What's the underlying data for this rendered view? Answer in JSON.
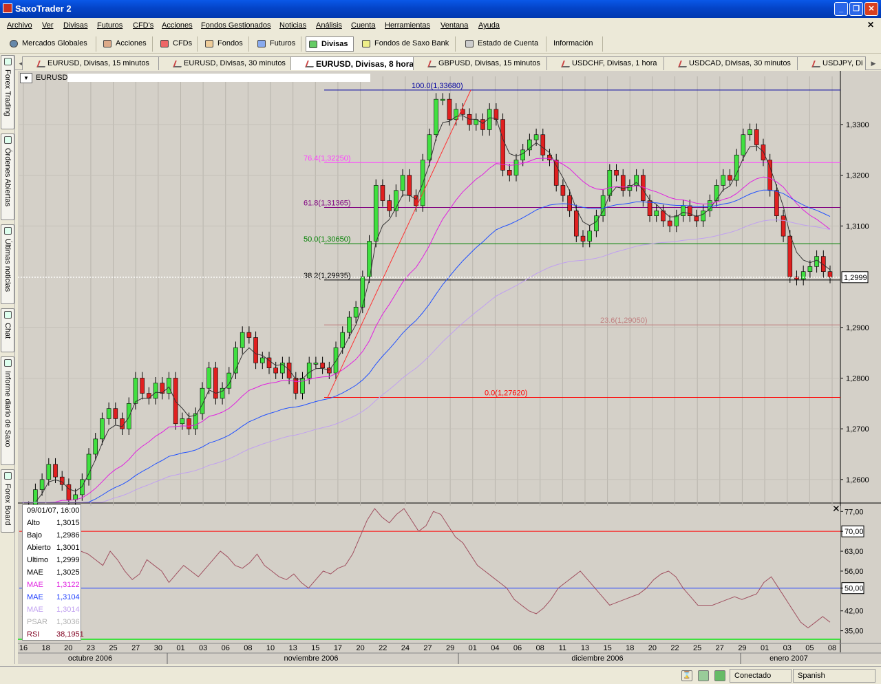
{
  "window": {
    "title": "SaxoTrader 2",
    "minimize_icon": "minimize-icon",
    "maximize_icon": "restore-icon",
    "close_icon": "close-icon"
  },
  "menu": {
    "items": [
      "Archivo",
      "Ver",
      "Divisas",
      "Futuros",
      "CFD's",
      "Acciones",
      "Fondos Gestionados",
      "Noticias",
      "Análisis",
      "Cuenta",
      "Herramientas",
      "Ventana",
      "Ayuda"
    ]
  },
  "toolbar": {
    "items": [
      {
        "label": "Mercados Globales",
        "icon": "globe-icon"
      },
      {
        "label": "Acciones",
        "icon": "stocks-icon"
      },
      {
        "label": "CFDs",
        "icon": "cfd-icon"
      },
      {
        "label": "Fondos",
        "icon": "funds-icon"
      },
      {
        "label": "Futuros",
        "icon": "futures-icon"
      },
      {
        "label": "Divisas",
        "icon": "forex-icon"
      },
      {
        "label": "Fondos de Saxo Bank",
        "icon": "saxo-funds-icon"
      },
      {
        "label": "Estado de Cuenta",
        "icon": "account-icon"
      },
      {
        "label": "Información",
        "icon": ""
      }
    ]
  },
  "sidebar": {
    "tabs": [
      "Forex Trading",
      "Órdenes Abiertas",
      "Últimas noticias",
      "Chat",
      "Informe diario de Saxo",
      "Forex Board"
    ]
  },
  "chart_tabs": [
    "EURUSD, Divisas, 15 minutos",
    "EURUSD, Divisas, 30 minutos",
    "EURUSD, Divisas, 8 horas",
    "GBPUSD, Divisas, 15 minutos",
    "USDCHF, Divisas, 1 hora",
    "USDCAD, Divisas, 30 minutos",
    "USDJPY, Di"
  ],
  "active_tab": 2,
  "symbol": "EURUSD",
  "chart_data": {
    "type": "line",
    "title": "EURUSD",
    "x_dates": [
      "16",
      "18",
      "20",
      "23",
      "25",
      "27",
      "30",
      "01",
      "03",
      "06",
      "08",
      "10",
      "13",
      "15",
      "17",
      "20",
      "22",
      "24",
      "27",
      "29",
      "01",
      "04",
      "06",
      "08",
      "11",
      "13",
      "15",
      "18",
      "20",
      "22",
      "25",
      "27",
      "29",
      "01",
      "03",
      "05",
      "08"
    ],
    "months": [
      "octubre 2006",
      "noviembre 2006",
      "diciembre 2006",
      "enero 2007"
    ],
    "price_axis": {
      "ticks": [
        "1,3300",
        "1,3200",
        "1,3100",
        "1,2999",
        "1,2900",
        "1,2800",
        "1,2700",
        "1,2600"
      ],
      "values": [
        1.33,
        1.32,
        1.31,
        1.2999,
        1.29,
        1.28,
        1.27,
        1.26
      ],
      "range": [
        1.2555,
        1.3395
      ],
      "current": "1,2999"
    },
    "fibonacci": [
      {
        "label": "100.0(1,33680)",
        "value": 1.3368,
        "color": "#0000a0"
      },
      {
        "label": "76.4(1,32250)",
        "value": 1.3225,
        "color": "#ff40ff"
      },
      {
        "label": "61.8(1,31365)",
        "value": 1.31365,
        "color": "#800080"
      },
      {
        "label": "50.0(1,30650)",
        "value": 1.3065,
        "color": "#008000"
      },
      {
        "label": "38.2(1,29935)",
        "value": 1.29935,
        "color": "#000000"
      },
      {
        "label": "23.6(1,29050)",
        "value": 1.2905,
        "color": "#c08080"
      },
      {
        "label": "0.0(1,27620)",
        "value": 1.2762,
        "color": "#ff0000"
      }
    ],
    "close_series": [
      1.253,
      1.2545,
      1.258,
      1.26,
      1.263,
      1.2605,
      1.259,
      1.256,
      1.257,
      1.26,
      1.265,
      1.268,
      1.272,
      1.274,
      1.272,
      1.27,
      1.275,
      1.28,
      1.277,
      1.276,
      1.279,
      1.277,
      1.28,
      1.271,
      1.272,
      1.27,
      1.273,
      1.278,
      1.282,
      1.276,
      1.278,
      1.281,
      1.286,
      1.289,
      1.288,
      1.283,
      1.284,
      1.282,
      1.281,
      1.283,
      1.28,
      1.277,
      1.28,
      1.283,
      1.283,
      1.282,
      1.281,
      1.286,
      1.289,
      1.292,
      1.294,
      1.3,
      1.307,
      1.318,
      1.315,
      1.313,
      1.317,
      1.32,
      1.316,
      1.314,
      1.323,
      1.328,
      1.335,
      1.335,
      1.331,
      1.333,
      1.332,
      1.33,
      1.331,
      1.329,
      1.333,
      1.331,
      1.321,
      1.32,
      1.323,
      1.325,
      1.327,
      1.328,
      1.324,
      1.323,
      1.318,
      1.316,
      1.313,
      1.308,
      1.307,
      1.309,
      1.312,
      1.316,
      1.321,
      1.32,
      1.317,
      1.318,
      1.32,
      1.315,
      1.312,
      1.313,
      1.311,
      1.31,
      1.312,
      1.314,
      1.312,
      1.311,
      1.313,
      1.315,
      1.318,
      1.32,
      1.319,
      1.324,
      1.328,
      1.329,
      1.326,
      1.323,
      1.317,
      1.312,
      1.308,
      1.3,
      1.2995,
      1.301,
      1.302,
      1.304,
      1.301,
      1.2999
    ],
    "rsi": {
      "ticks": [
        "77,00",
        "70,00",
        "63,00",
        "56,00",
        "50,00",
        "42,00",
        "35,00"
      ],
      "values": [
        77,
        70,
        63,
        56,
        50,
        42,
        35
      ],
      "range": [
        32,
        79
      ],
      "levels": [
        70,
        50
      ],
      "series": [
        40,
        44,
        47,
        46,
        50,
        54,
        58,
        61,
        63,
        62,
        60,
        58,
        63,
        60,
        56,
        53,
        55,
        60,
        58,
        56,
        52,
        55,
        58,
        56,
        54,
        57,
        60,
        63,
        61,
        58,
        57,
        59,
        62,
        58,
        56,
        54,
        53,
        55,
        52,
        50,
        53,
        56,
        55,
        57,
        58,
        62,
        68,
        74,
        78,
        75,
        73,
        76,
        78,
        74,
        70,
        72,
        77,
        76,
        72,
        68,
        66,
        62,
        58,
        56,
        54,
        52,
        50,
        46,
        44,
        42,
        41,
        43,
        46,
        50,
        52,
        54,
        56,
        53,
        50,
        47,
        44,
        45,
        46,
        47,
        48,
        50,
        53,
        55,
        56,
        54,
        50,
        47,
        44,
        44,
        44,
        45,
        46,
        47,
        46,
        47,
        48,
        52,
        54,
        50,
        46,
        42,
        38,
        36,
        38,
        40,
        38
      ],
      "label": "RSI"
    }
  },
  "info_box": {
    "rows": [
      {
        "k": "09/01/07, 16:00",
        "v": "",
        "color": "#000000"
      },
      {
        "k": "Alto",
        "v": "1,3015",
        "color": "#000000"
      },
      {
        "k": "Bajo",
        "v": "1,2986",
        "color": "#000000"
      },
      {
        "k": "Abierto",
        "v": "1,3001",
        "color": "#000000"
      },
      {
        "k": "Ultimo",
        "v": "1,2999",
        "color": "#000000"
      },
      {
        "k": "MAE",
        "v": "1,3025",
        "color": "#000000"
      },
      {
        "k": "MAE",
        "v": "1,3122",
        "color": "#e020e0"
      },
      {
        "k": "MAE",
        "v": "1,3104",
        "color": "#2040ff"
      },
      {
        "k": "MAE",
        "v": "1,3014",
        "color": "#c0a0f0"
      },
      {
        "k": "PSAR",
        "v": "1,3036",
        "color": "#b0b0b0"
      },
      {
        "k": "RSI",
        "v": "38,1951",
        "color": "#800020"
      }
    ]
  },
  "status": {
    "connection": "Conectado",
    "language": "Spanish"
  }
}
